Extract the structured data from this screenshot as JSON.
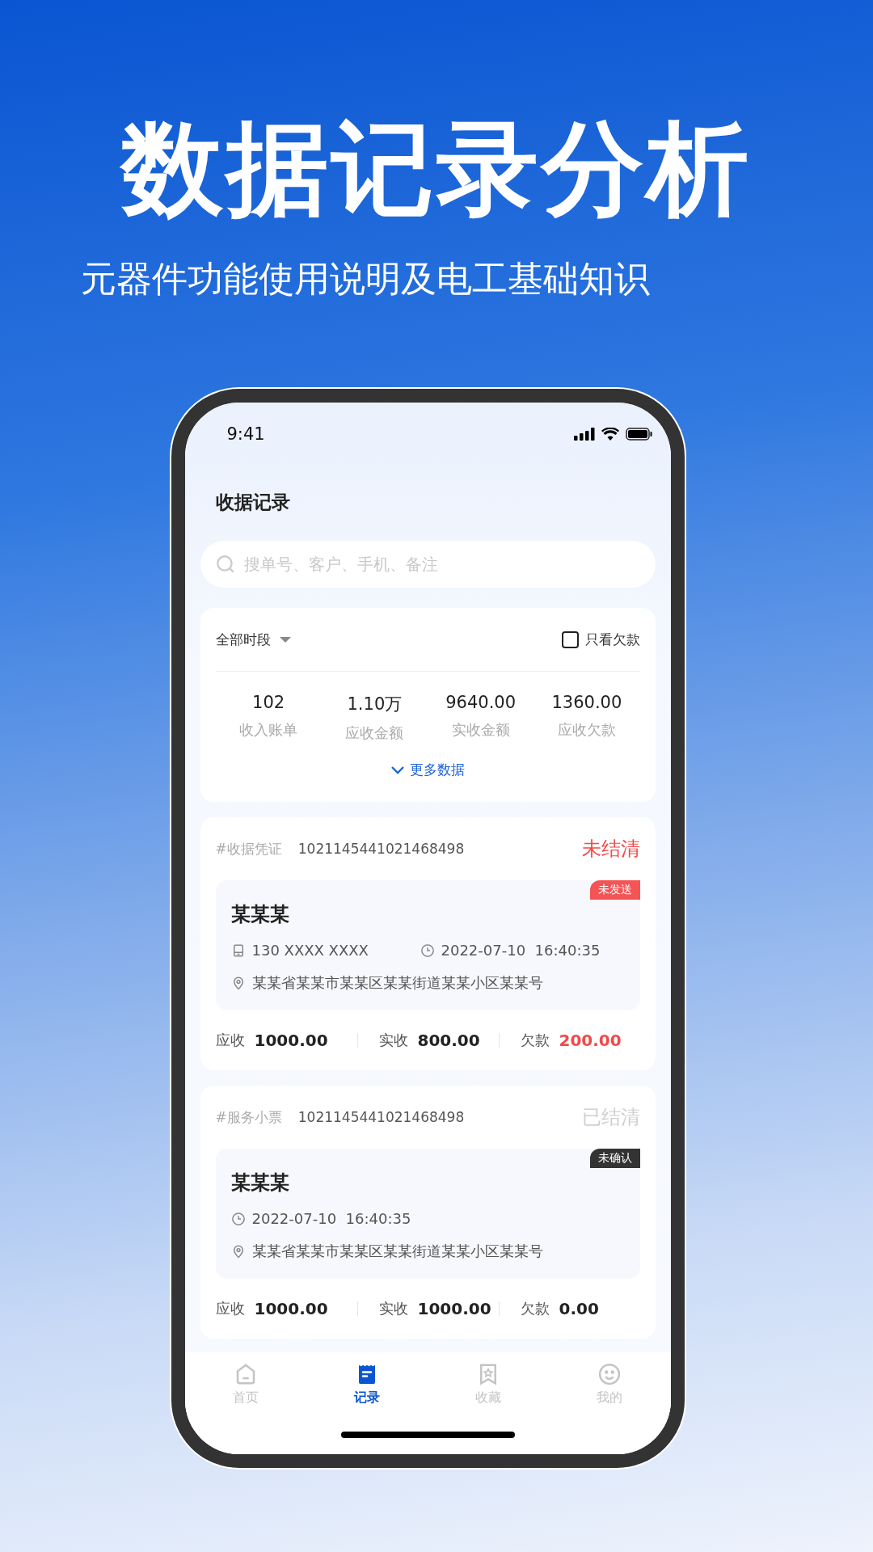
{
  "headline": "数据记录分析",
  "subtitle": "元器件功能使用说明及电工基础知识",
  "status_bar": {
    "time": "9:41"
  },
  "page_title": "收据记录",
  "search": {
    "placeholder": "搜单号、客户、手机、备注"
  },
  "summary": {
    "period": "全部时段",
    "only_debt": {
      "label": "只看欠款",
      "checked": false
    },
    "stats": [
      {
        "value": "102",
        "label": "收入账单"
      },
      {
        "value": "1.10万",
        "label": "应收金额"
      },
      {
        "value": "9640.00",
        "label": "实收金额"
      },
      {
        "value": "1360.00",
        "label": "应收欠款"
      }
    ],
    "more": "更多数据"
  },
  "records": [
    {
      "type": "#收据凭证",
      "number": "1021145441021468498",
      "status": {
        "text": "未结清",
        "kind": "unsettled"
      },
      "tag": {
        "text": "未发送",
        "kind": "unsent"
      },
      "name": "某某某",
      "phone": "130 XXXX XXXX",
      "time": "2022-07-10  16:40:35",
      "address": "某某省某某市某某区某某街道某某小区某某号",
      "amounts": [
        {
          "label": "应收",
          "value": "1000.00",
          "highlight": false
        },
        {
          "label": "实收",
          "value": "800.00",
          "highlight": false
        },
        {
          "label": "欠款",
          "value": "200.00",
          "highlight": true
        }
      ]
    },
    {
      "type": "#服务小票",
      "number": "1021145441021468498",
      "status": {
        "text": "已结清",
        "kind": "settled"
      },
      "tag": {
        "text": "未确认",
        "kind": "unconfirmed"
      },
      "name": "某某某",
      "time": "2022-07-10  16:40:35",
      "address": "某某省某某市某某区某某街道某某小区某某号",
      "amounts": [
        {
          "label": "应收",
          "value": "1000.00",
          "highlight": false
        },
        {
          "label": "实收",
          "value": "1000.00",
          "highlight": false
        },
        {
          "label": "欠款",
          "value": "0.00",
          "highlight": false
        }
      ]
    }
  ],
  "tabs": [
    {
      "label": "首页",
      "kind": "home",
      "selected": false
    },
    {
      "label": "记录",
      "kind": "record",
      "selected": true
    },
    {
      "label": "收藏",
      "kind": "bookmark",
      "selected": false
    },
    {
      "label": "我的",
      "kind": "smile",
      "selected": false
    }
  ]
}
